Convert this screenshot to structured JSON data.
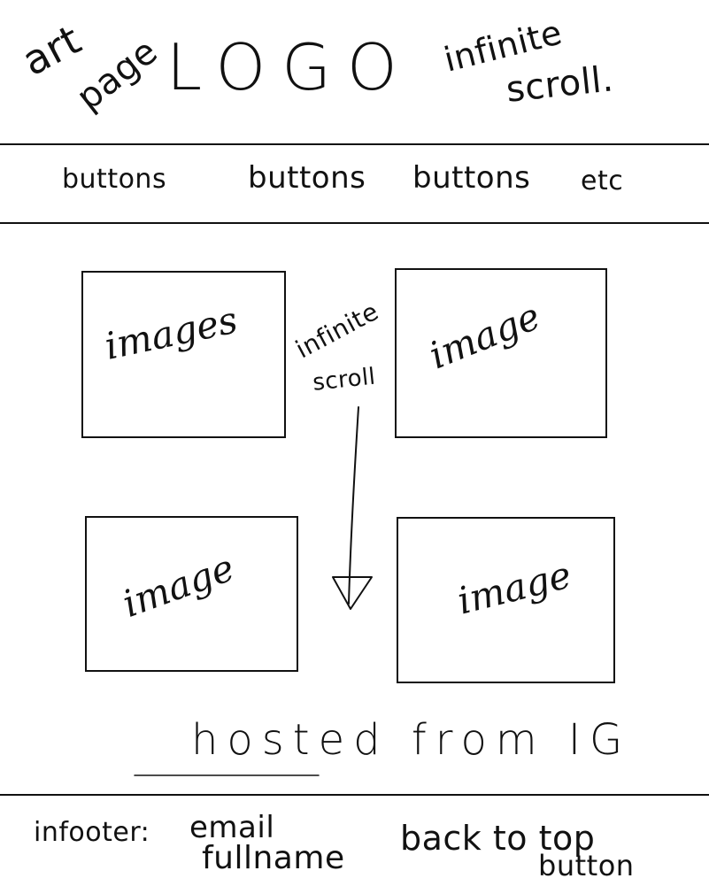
{
  "header": {
    "art_page": [
      "art",
      "page"
    ],
    "logo": "LOGO",
    "infinite_scroll": [
      "infinite",
      "scroll."
    ]
  },
  "nav": {
    "buttons": [
      "buttons",
      "buttons",
      "buttons"
    ],
    "etc": "etc"
  },
  "gallery": {
    "images": [
      "images",
      "image",
      "image",
      "image"
    ],
    "scroll_note": [
      "infinite",
      "scroll"
    ]
  },
  "source_note": "hosted from IG",
  "footer": {
    "prefix": "infooter:",
    "email": "email",
    "full_name": "fullname",
    "back_to_top": [
      "back to top",
      "button"
    ]
  }
}
